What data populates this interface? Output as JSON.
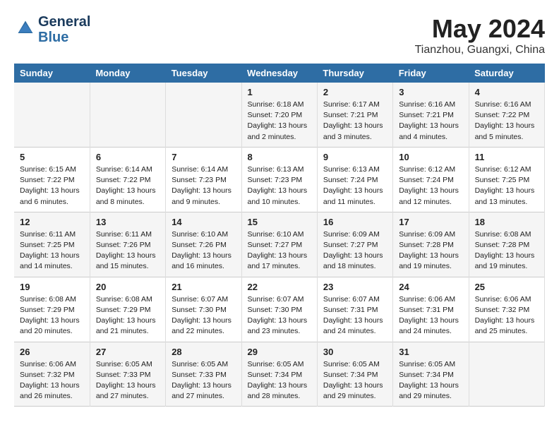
{
  "header": {
    "logo_line1": "General",
    "logo_line2": "Blue",
    "month_title": "May 2024",
    "location": "Tianzhou, Guangxi, China"
  },
  "weekdays": [
    "Sunday",
    "Monday",
    "Tuesday",
    "Wednesday",
    "Thursday",
    "Friday",
    "Saturday"
  ],
  "weeks": [
    [
      {
        "day": "",
        "info": ""
      },
      {
        "day": "",
        "info": ""
      },
      {
        "day": "",
        "info": ""
      },
      {
        "day": "1",
        "info": "Sunrise: 6:18 AM\nSunset: 7:20 PM\nDaylight: 13 hours\nand 2 minutes."
      },
      {
        "day": "2",
        "info": "Sunrise: 6:17 AM\nSunset: 7:21 PM\nDaylight: 13 hours\nand 3 minutes."
      },
      {
        "day": "3",
        "info": "Sunrise: 6:16 AM\nSunset: 7:21 PM\nDaylight: 13 hours\nand 4 minutes."
      },
      {
        "day": "4",
        "info": "Sunrise: 6:16 AM\nSunset: 7:22 PM\nDaylight: 13 hours\nand 5 minutes."
      }
    ],
    [
      {
        "day": "5",
        "info": "Sunrise: 6:15 AM\nSunset: 7:22 PM\nDaylight: 13 hours\nand 6 minutes."
      },
      {
        "day": "6",
        "info": "Sunrise: 6:14 AM\nSunset: 7:22 PM\nDaylight: 13 hours\nand 8 minutes."
      },
      {
        "day": "7",
        "info": "Sunrise: 6:14 AM\nSunset: 7:23 PM\nDaylight: 13 hours\nand 9 minutes."
      },
      {
        "day": "8",
        "info": "Sunrise: 6:13 AM\nSunset: 7:23 PM\nDaylight: 13 hours\nand 10 minutes."
      },
      {
        "day": "9",
        "info": "Sunrise: 6:13 AM\nSunset: 7:24 PM\nDaylight: 13 hours\nand 11 minutes."
      },
      {
        "day": "10",
        "info": "Sunrise: 6:12 AM\nSunset: 7:24 PM\nDaylight: 13 hours\nand 12 minutes."
      },
      {
        "day": "11",
        "info": "Sunrise: 6:12 AM\nSunset: 7:25 PM\nDaylight: 13 hours\nand 13 minutes."
      }
    ],
    [
      {
        "day": "12",
        "info": "Sunrise: 6:11 AM\nSunset: 7:25 PM\nDaylight: 13 hours\nand 14 minutes."
      },
      {
        "day": "13",
        "info": "Sunrise: 6:11 AM\nSunset: 7:26 PM\nDaylight: 13 hours\nand 15 minutes."
      },
      {
        "day": "14",
        "info": "Sunrise: 6:10 AM\nSunset: 7:26 PM\nDaylight: 13 hours\nand 16 minutes."
      },
      {
        "day": "15",
        "info": "Sunrise: 6:10 AM\nSunset: 7:27 PM\nDaylight: 13 hours\nand 17 minutes."
      },
      {
        "day": "16",
        "info": "Sunrise: 6:09 AM\nSunset: 7:27 PM\nDaylight: 13 hours\nand 18 minutes."
      },
      {
        "day": "17",
        "info": "Sunrise: 6:09 AM\nSunset: 7:28 PM\nDaylight: 13 hours\nand 19 minutes."
      },
      {
        "day": "18",
        "info": "Sunrise: 6:08 AM\nSunset: 7:28 PM\nDaylight: 13 hours\nand 19 minutes."
      }
    ],
    [
      {
        "day": "19",
        "info": "Sunrise: 6:08 AM\nSunset: 7:29 PM\nDaylight: 13 hours\nand 20 minutes."
      },
      {
        "day": "20",
        "info": "Sunrise: 6:08 AM\nSunset: 7:29 PM\nDaylight: 13 hours\nand 21 minutes."
      },
      {
        "day": "21",
        "info": "Sunrise: 6:07 AM\nSunset: 7:30 PM\nDaylight: 13 hours\nand 22 minutes."
      },
      {
        "day": "22",
        "info": "Sunrise: 6:07 AM\nSunset: 7:30 PM\nDaylight: 13 hours\nand 23 minutes."
      },
      {
        "day": "23",
        "info": "Sunrise: 6:07 AM\nSunset: 7:31 PM\nDaylight: 13 hours\nand 24 minutes."
      },
      {
        "day": "24",
        "info": "Sunrise: 6:06 AM\nSunset: 7:31 PM\nDaylight: 13 hours\nand 24 minutes."
      },
      {
        "day": "25",
        "info": "Sunrise: 6:06 AM\nSunset: 7:32 PM\nDaylight: 13 hours\nand 25 minutes."
      }
    ],
    [
      {
        "day": "26",
        "info": "Sunrise: 6:06 AM\nSunset: 7:32 PM\nDaylight: 13 hours\nand 26 minutes."
      },
      {
        "day": "27",
        "info": "Sunrise: 6:05 AM\nSunset: 7:33 PM\nDaylight: 13 hours\nand 27 minutes."
      },
      {
        "day": "28",
        "info": "Sunrise: 6:05 AM\nSunset: 7:33 PM\nDaylight: 13 hours\nand 27 minutes."
      },
      {
        "day": "29",
        "info": "Sunrise: 6:05 AM\nSunset: 7:34 PM\nDaylight: 13 hours\nand 28 minutes."
      },
      {
        "day": "30",
        "info": "Sunrise: 6:05 AM\nSunset: 7:34 PM\nDaylight: 13 hours\nand 29 minutes."
      },
      {
        "day": "31",
        "info": "Sunrise: 6:05 AM\nSunset: 7:34 PM\nDaylight: 13 hours\nand 29 minutes."
      },
      {
        "day": "",
        "info": ""
      }
    ]
  ]
}
